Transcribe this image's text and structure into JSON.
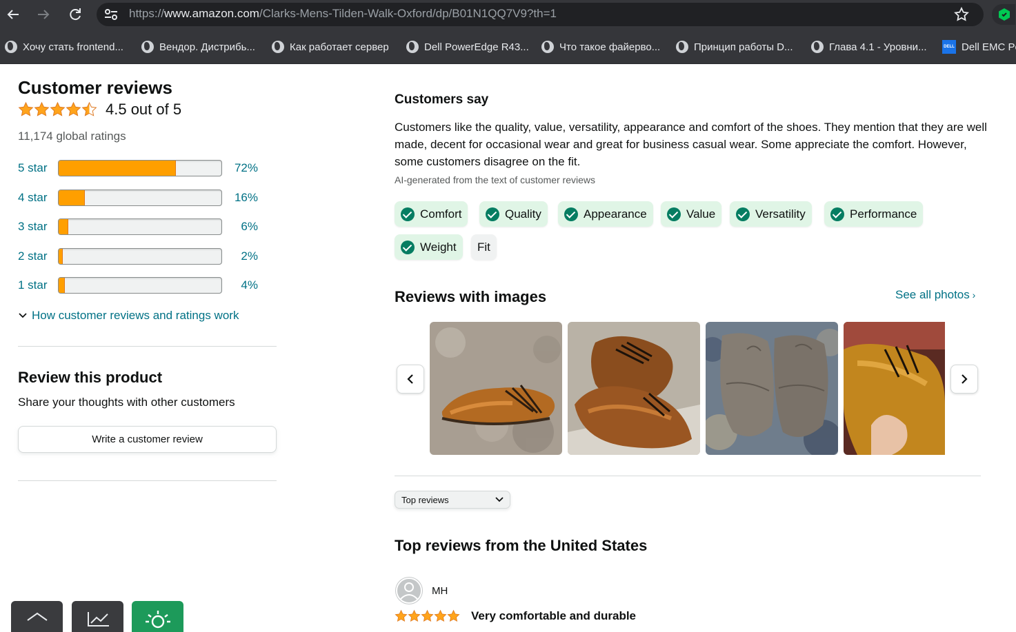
{
  "browser": {
    "url_prefix": "https://",
    "url_domain": "www.amazon.com",
    "url_path": "/Clarks-Mens-Tilden-Walk-Oxford/dp/B01N1QQ7V9?th=1",
    "bookmarks": [
      {
        "label": "Хочу стать frontend...",
        "icon": "globe-icon"
      },
      {
        "label": "Вендор. Дистрибь...",
        "icon": "globe-icon"
      },
      {
        "label": "Как работает сервер",
        "icon": "globe-icon"
      },
      {
        "label": "Dell PowerEdge R43...",
        "icon": "globe-icon"
      },
      {
        "label": "Что такое файерво...",
        "icon": "globe-icon"
      },
      {
        "label": "Принцип работы D...",
        "icon": "globe-icon"
      },
      {
        "label": "Глава 4.1 - Уровни...",
        "icon": "globe-icon"
      },
      {
        "label": "Dell EMC Po",
        "icon": "dell-icon"
      }
    ]
  },
  "reviews_summary": {
    "title": "Customer reviews",
    "rating_text": "4.5 out of 5",
    "rating_value": 4.5,
    "global_ratings": "11,174 global ratings",
    "histogram": [
      {
        "label": "5 star",
        "percent_text": "72%",
        "percent": 72
      },
      {
        "label": "4 star",
        "percent_text": "16%",
        "percent": 16
      },
      {
        "label": "3 star",
        "percent_text": "6%",
        "percent": 6
      },
      {
        "label": "2 star",
        "percent_text": "2%",
        "percent": 2
      },
      {
        "label": "1 star",
        "percent_text": "4%",
        "percent": 4
      }
    ],
    "how_link": "How customer reviews and ratings work"
  },
  "review_product": {
    "title": "Review this product",
    "subtitle": "Share your thoughts with other customers",
    "button": "Write a customer review"
  },
  "customers_say": {
    "title": "Customers say",
    "body": "Customers like the quality, value, versatility, appearance and comfort of the shoes. They mention that they are well made, decent for occasional wear and great for business casual wear. Some appreciate the comfort. However, some customers disagree on the fit.",
    "ai_note": "AI-generated from the text of customer reviews",
    "chips": [
      {
        "label": "Comfort",
        "positive": true
      },
      {
        "label": "Quality",
        "positive": true
      },
      {
        "label": "Appearance",
        "positive": true
      },
      {
        "label": "Value",
        "positive": true
      },
      {
        "label": "Versatility",
        "positive": true
      },
      {
        "label": "Performance",
        "positive": true
      },
      {
        "label": "Weight",
        "positive": true
      },
      {
        "label": "Fit",
        "positive": false
      }
    ]
  },
  "reviews_with_images": {
    "title": "Reviews with images",
    "see_all": "See all photos"
  },
  "sort": {
    "selected": "Top reviews"
  },
  "top_reviews": {
    "title": "Top reviews from the United States",
    "first": {
      "reviewer": "MH",
      "stars": 5,
      "headline": "Very comfortable and durable"
    }
  },
  "colors": {
    "link": "#007185",
    "star": "#ffa41c",
    "bar_fill": "#ff9f00",
    "chip_positive": "#e0f5e6",
    "check": "#067d62"
  }
}
